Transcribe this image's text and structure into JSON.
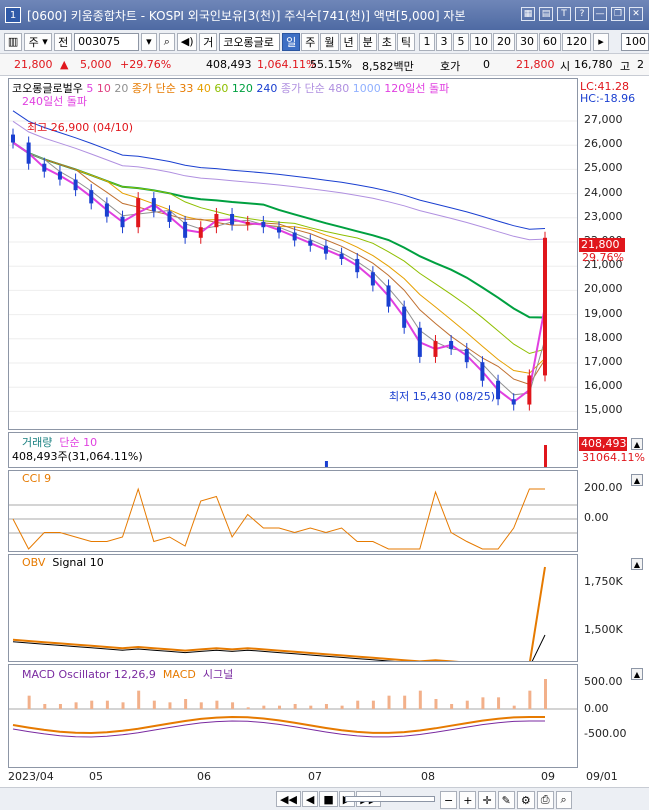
{
  "window": {
    "badge": "1",
    "title": "[0600] 키움종합차트 - KOSPI 외국인보유[3(천)] 주식수[741(천)] 액면[5,000] 자본",
    "icons": [
      "grid-icon",
      "camera-icon",
      "text-icon",
      "help-icon",
      "minimize-icon",
      "restore-icon",
      "close-icon"
    ],
    "icon_glyphs": [
      "▦",
      "▤",
      "T",
      "?",
      "—",
      "❐",
      "✕"
    ]
  },
  "toolbar": {
    "market": "주",
    "search_label": "전",
    "code": "003075",
    "sound_glyph": "◀)",
    "type_label": "거",
    "name": "코오롱글로",
    "periods": [
      "일",
      "주",
      "월",
      "년",
      "분",
      "초",
      "틱"
    ],
    "active_period": "일",
    "intervals": [
      "1",
      "3",
      "5",
      "10",
      "20",
      "30",
      "60",
      "120"
    ],
    "count": "100"
  },
  "quote": {
    "price": "21,800",
    "up_arrow": "▲",
    "change": "5,000",
    "change_pct": "+29.76%",
    "volume": "408,493",
    "volume_ratio": "1,064.11%",
    "turnover_pct": "55.15%",
    "amount": "8,582백만",
    "bid_label": "호가",
    "bid_value": "0",
    "ask_price": "21,800",
    "open_label": "시",
    "open_value": "16,780",
    "high_label": "고",
    "high_value": "2"
  },
  "price_panel": {
    "legend_name": "코오롱글로벌우",
    "legend_ma": [
      "5",
      "10",
      "20"
    ],
    "legend_ma_colors": [
      "#e040e0",
      "#e04080",
      "#909090"
    ],
    "legend_close_ma": "종가 단순 33",
    "legend_close_ma2": [
      "40",
      "60",
      "120",
      "240"
    ],
    "legend_close_ma2_colors": [
      "#e6a000",
      "#8fbf00",
      "#00a040",
      "#1a3fd0"
    ],
    "legend_close_ma3": "종가 단순 480",
    "legend_1000": "1000",
    "legend_breakout": "120일선 돌파",
    "legend_breakout2": "240일선 돌파",
    "lc": "LC:41.28",
    "hc": "HC:-18.96",
    "high_marker": "최고 26,900 (04/10)",
    "low_marker": "최저 15,430 (08/25)",
    "current_price": "21,800",
    "current_pct": "29.76%",
    "y_ticks": [
      "27,000",
      "26,000",
      "25,000",
      "24,000",
      "23,000",
      "22,000",
      "21,000",
      "20,000",
      "19,000",
      "18,000",
      "17,000",
      "16,000",
      "15,000"
    ]
  },
  "volume_panel": {
    "legend": "거래량",
    "legend_ma": "단순 10",
    "value": "408,493주(31,064.11%)",
    "box_value": "408,493",
    "box_sub": "31064.11%"
  },
  "cci_panel": {
    "legend": "CCI 9",
    "y_ticks": [
      "200.00",
      "0.00"
    ]
  },
  "obv_panel": {
    "legend": "OBV",
    "legend_signal": "Signal 10",
    "y_ticks": [
      "1,750K",
      "1,500K"
    ]
  },
  "macd_panel": {
    "legend": "MACD Oscillator 12,26,9",
    "legend_macd": "MACD",
    "legend_signal": "시그널",
    "y_ticks": [
      "500.00",
      "0.00",
      "-500.00"
    ]
  },
  "x_axis": [
    "2023/04",
    "05",
    "06",
    "07",
    "08",
    "09",
    "09/01"
  ],
  "bottom_bar": {
    "buttons": [
      "◀◀",
      "◀",
      "■",
      "▶",
      "▶▶"
    ]
  },
  "chart_data": {
    "type": "candlestick",
    "y_range": [
      14500,
      27800
    ],
    "close_approx": [
      25400,
      24600,
      24300,
      24000,
      23600,
      23100,
      22600,
      22200,
      23300,
      22800,
      22400,
      21800,
      22200,
      22700,
      22300,
      22400,
      22200,
      22000,
      21700,
      21500,
      21200,
      21000,
      20500,
      20000,
      19200,
      18400,
      17300,
      17900,
      17600,
      17100,
      16400,
      15700,
      15500,
      16600,
      21800
    ]
  }
}
